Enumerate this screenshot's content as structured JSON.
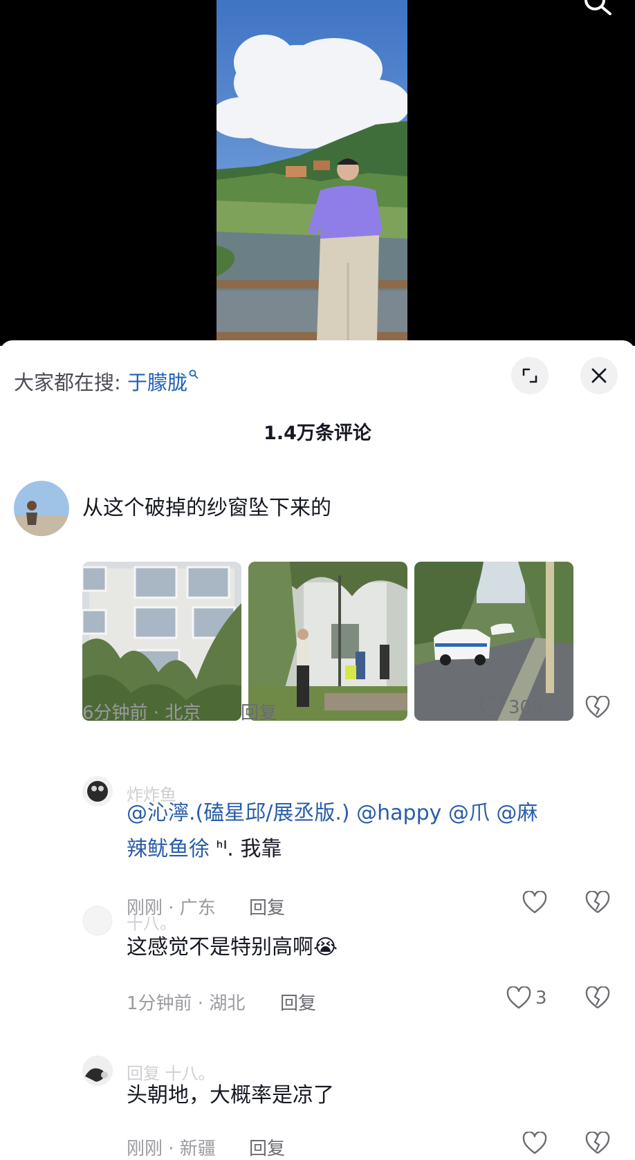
{
  "search_hint": {
    "prefix": "大家都在搜:",
    "keyword": "于朦胧"
  },
  "comments_count": "1.4万条评论",
  "comments": [
    {
      "username": "",
      "text": "从这个破掉的纱窗坠下来的",
      "time_location": "6分钟前 · 北京",
      "reply_label": "回复",
      "likes": "308",
      "images": [
        "building-window-photo",
        "police-scene-photo",
        "police-car-photo"
      ]
    }
  ],
  "replies": [
    {
      "username": "炸炸鱼",
      "mention_text": "@沁濘.(磕星邱/展丞版.) @happy @爪 @麻辣鱿鱼徐",
      "mention_line1": "@沁濘.(磕星邱/展丞版.) @happy @爪 @麻",
      "mention_line2": "辣鱿鱼徐",
      "text_tail": "ᑋᑊ. 我靠",
      "time_location": "刚刚 · 广东",
      "reply_label": "回复",
      "likes": ""
    },
    {
      "username": "十八。",
      "text": "这感觉不是特别高啊😭",
      "time_location": "1分钟前 · 湖北",
      "reply_label": "回复",
      "likes": "3"
    },
    {
      "username": "回复 十八。",
      "text": "头朝地，大概率是凉了",
      "time_location": "刚刚 · 新疆",
      "reply_label": "回复",
      "likes": ""
    }
  ],
  "icons": {
    "top_search": "search-icon",
    "expand": "expand-icon",
    "close": "close-icon",
    "like": "heart-icon",
    "dislike": "broken-heart-icon"
  },
  "colors": {
    "mention": "#2a5caa",
    "keyword": "#1f5fb8",
    "meta": "#9a9aa0"
  }
}
